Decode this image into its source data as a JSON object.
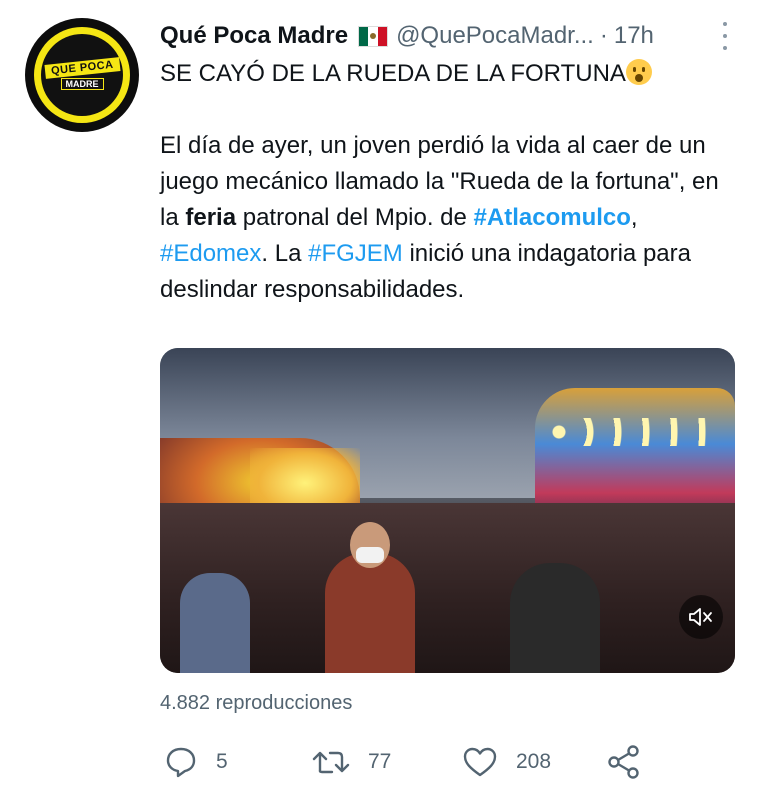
{
  "author": {
    "display_name": "Qué Poca Madre",
    "handle": "@QuePocaMadr...",
    "separator": "·",
    "time": "17h",
    "logo_text_top": "QUE POCA",
    "logo_text_bottom": "MADRE",
    "flag": "mexico-flag-icon"
  },
  "tweet": {
    "headline": "SE CAYÓ DE LA RUEDA DE LA FORTUNA",
    "emoji": "astonished-face-icon",
    "body_part1": "El día de ayer, un joven perdió la vida al caer de un juego mecánico llamado la \"Rueda de la fortuna\", en la ",
    "bold_word": "feria",
    "body_part2": " patronal del Mpio. de ",
    "hashtag1": "#Atlacomulco",
    "comma": ", ",
    "hashtag2": "#Edomex",
    "body_part3": ".  La ",
    "hashtag3": "#FGJEM",
    "body_part4": " inició una indagatoria para deslindar responsabilidades."
  },
  "media": {
    "type": "video",
    "mute_icon": "speaker-muted-icon"
  },
  "views_text": "4.882 reproducciones",
  "actions": {
    "reply_count": "5",
    "retweet_count": "77",
    "like_count": "208"
  },
  "colors": {
    "link": "#1d9bf0",
    "secondary_text": "#536471",
    "primary_text": "#0f1419",
    "logo_yellow": "#f5e614"
  }
}
